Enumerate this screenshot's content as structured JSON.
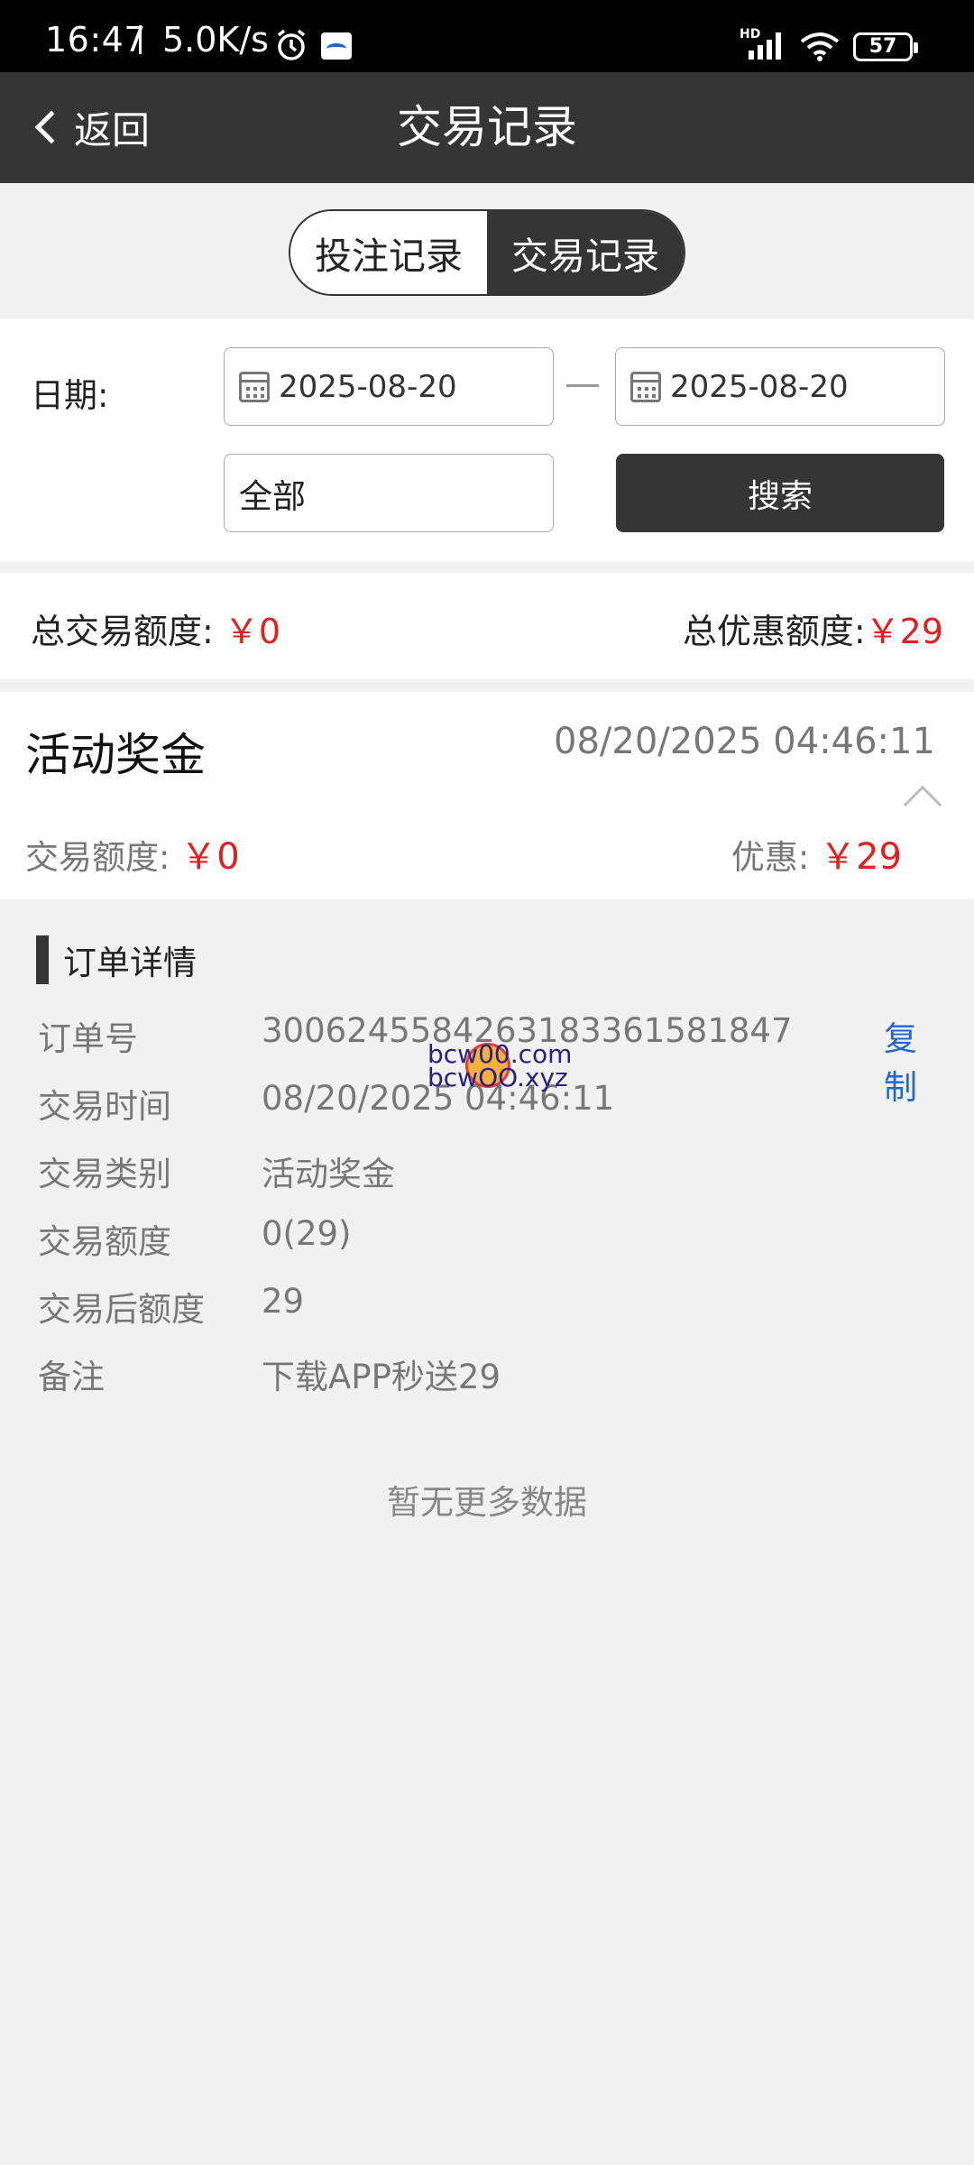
{
  "status_bar": {
    "time": "16:47",
    "speed": "5.0K/s",
    "battery": "57",
    "hd": "HD",
    "icons": [
      "alarm-icon",
      "app-notification-icon",
      "signal-icon",
      "wifi-icon",
      "battery-icon"
    ]
  },
  "header": {
    "back_label": "返回",
    "title": "交易记录"
  },
  "tabs": [
    {
      "label": "投注记录",
      "active": false
    },
    {
      "label": "交易记录",
      "active": true
    }
  ],
  "filter": {
    "date_label": "日期:",
    "start_date": "2025-08-20",
    "end_date": "2025-08-20",
    "type_value": "全部",
    "search_label": "搜索"
  },
  "totals": {
    "trade_label": "总交易额度:",
    "trade_value": "￥0",
    "discount_label": "总优惠额度:",
    "discount_value": "￥29"
  },
  "record": {
    "title": "活动奖金",
    "time": "08/20/2025  04:46:11",
    "amount_label": "交易额度:",
    "amount_value": "￥0",
    "discount_label": "优惠:",
    "discount_value": "￥29"
  },
  "details": {
    "title": "订单详情",
    "rows": [
      {
        "key": "订单号",
        "value": "3006245584263183361581847"
      },
      {
        "key": "交易时间",
        "value": "08/20/2025  04:46:11"
      },
      {
        "key": "交易类别",
        "value": "活动奖金"
      },
      {
        "key": "交易额度",
        "value": "0(29)"
      },
      {
        "key": "交易后额度",
        "value": "29"
      },
      {
        "key": "备注",
        "value": "下载APP秒送29"
      }
    ],
    "copy_label": "复制",
    "no_more": "暂无更多数据"
  },
  "watermark": {
    "line1": "bcw00.com",
    "line2": "bcwOO.xyz"
  },
  "colors": {
    "header_bg": "#353535",
    "accent_red": "#e02020",
    "link_blue": "#2166cf"
  }
}
